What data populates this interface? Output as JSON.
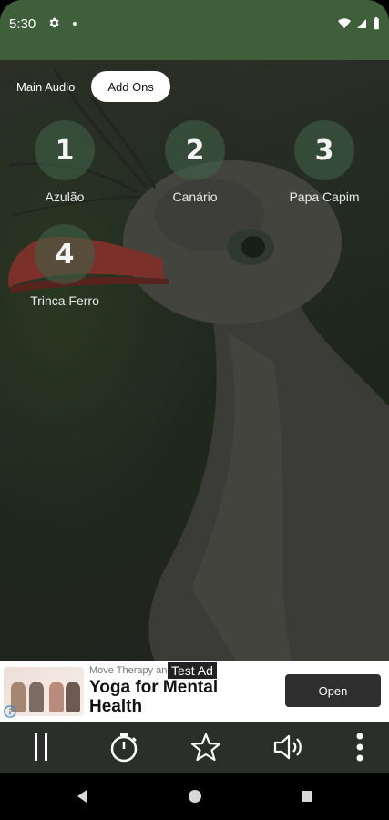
{
  "status_bar": {
    "time": "5:30"
  },
  "tabs": [
    {
      "label": "Main Audio",
      "active": false
    },
    {
      "label": "Add Ons",
      "active": true
    }
  ],
  "audio_items": [
    {
      "number": "1",
      "label": "Azulão"
    },
    {
      "number": "2",
      "label": "Canário"
    },
    {
      "number": "3",
      "label": "Papa Capim"
    },
    {
      "number": "4",
      "label": "Trinca Ferro"
    }
  ],
  "ad": {
    "subtitle": "Move Therapy and",
    "badge": "Test Ad",
    "title": "Yoga for Mental Health",
    "cta": "Open"
  },
  "controls": [
    {
      "icon": "pause-icon"
    },
    {
      "icon": "timer-icon"
    },
    {
      "icon": "star-icon"
    },
    {
      "icon": "volume-icon"
    },
    {
      "icon": "more-vert-icon"
    }
  ],
  "navbar": [
    {
      "icon": "back-icon"
    },
    {
      "icon": "home-icon"
    },
    {
      "icon": "recents-icon"
    }
  ],
  "colors": {
    "status_bar": "#3f5f3b",
    "controls_bar": "#2b2f29",
    "tab_active": "#ffffff",
    "ad_button": "#2f2f2f"
  }
}
